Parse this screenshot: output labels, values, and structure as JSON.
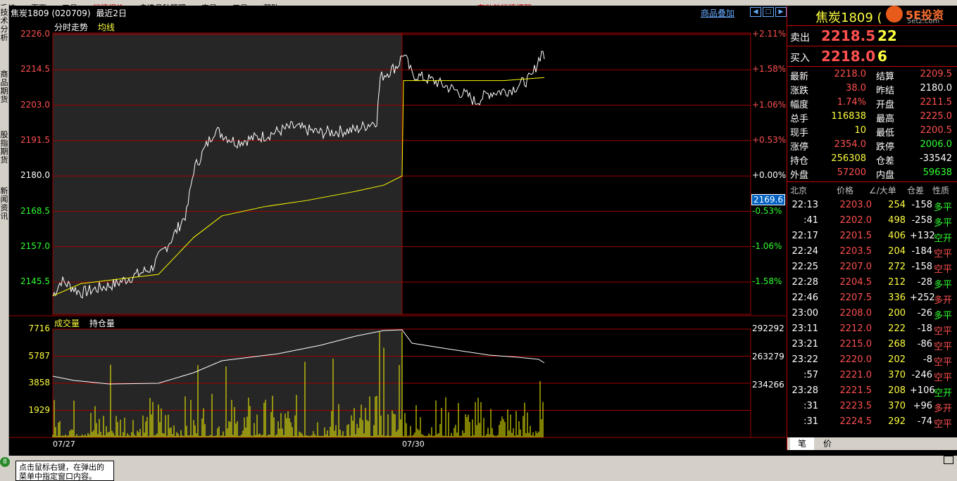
{
  "menubar": {
    "items": [
      "系统",
      "页面",
      "工具",
      "行情报价",
      "自选品种管理",
      "交易",
      "工具",
      "帮助"
    ],
    "highlight_index": 3,
    "notice": "有动效行情提醒"
  },
  "left_tabs": [
    "技术分析",
    "商品期货",
    "股指期货",
    "新闻资讯"
  ],
  "header": {
    "instrument": "焦炭1809 (020709)",
    "range": "最近2日",
    "overlay_btn": "商品叠加"
  },
  "price_panel": {
    "tab_label": "分时走势",
    "avg_label": "均线",
    "left_ticks": [
      "2226.0",
      "2214.5",
      "2203.0",
      "2191.5",
      "2180.0",
      "2168.5",
      "2157.0",
      "2145.5"
    ],
    "right_ticks": [
      "+2.11%",
      "+1.58%",
      "+1.06%",
      "+0.53%",
      "+0.00%",
      "-0.53%",
      "-1.06%",
      "-1.58%"
    ],
    "cursor_price": "2169.6"
  },
  "volume_panel": {
    "vol_label": "成交量",
    "oi_label": "持仓量",
    "left_ticks": [
      "7716",
      "5787",
      "3858",
      "1929"
    ],
    "right_ticks": [
      "292292",
      "263279",
      "234266"
    ]
  },
  "dates": [
    "07/27",
    "07/30"
  ],
  "colors": {
    "up": "#ff5050",
    "down": "#30ff30",
    "grid": "#a00000",
    "price": "#ffffff",
    "avg": "#ffff00",
    "volume": "#ffff00"
  },
  "quote": {
    "title": "焦炭1809 (",
    "brand": "5E投资",
    "brand_site": "5etz.com",
    "sell_label": "卖出",
    "sell_price": "2218.5",
    "sell_qty": "22",
    "buy_label": "买入",
    "buy_price": "2218.0",
    "buy_qty": "6",
    "stats": [
      {
        "l1": "最新",
        "v1": "2218.0",
        "c1": "red",
        "l2": "结算",
        "v2": "2209.5",
        "c2": "red"
      },
      {
        "l1": "涨跌",
        "v1": "38.0",
        "c1": "red",
        "l2": "昨结",
        "v2": "2180.0",
        "c2": "wht"
      },
      {
        "l1": "幅度",
        "v1": "1.74%",
        "c1": "red",
        "l2": "开盘",
        "v2": "2211.5",
        "c2": "red"
      },
      {
        "l1": "总手",
        "v1": "116838",
        "c1": "yel",
        "l2": "最高",
        "v2": "2225.0",
        "c2": "red"
      },
      {
        "l1": "现手",
        "v1": "10",
        "c1": "yel",
        "l2": "最低",
        "v2": "2200.5",
        "c2": "red"
      },
      {
        "l1": "涨停",
        "v1": "2354.0",
        "c1": "red",
        "l2": "跌停",
        "v2": "2006.0",
        "c2": "green"
      },
      {
        "l1": "持仓",
        "v1": "256308",
        "c1": "yel",
        "l2": "仓差",
        "v2": "-33542",
        "c2": "wht"
      },
      {
        "l1": "外盘",
        "v1": "57200",
        "c1": "red",
        "l2": "内盘",
        "v2": "59638",
        "c2": "green"
      }
    ],
    "tick_headers": [
      "北京",
      "价格",
      "∠/大单",
      "仓差",
      "性质"
    ],
    "ticks": [
      {
        "t": "22:13",
        "p": "2203.0",
        "v": "254",
        "d": "-158",
        "n": "多平",
        "nc": "green"
      },
      {
        "t": ":41",
        "p": "2202.0",
        "v": "498",
        "d": "-258",
        "n": "多平",
        "nc": "green"
      },
      {
        "t": "22:17",
        "p": "2201.5",
        "v": "406",
        "d": "+132",
        "n": "空开",
        "nc": "green"
      },
      {
        "t": "22:24",
        "p": "2203.5",
        "v": "204",
        "d": "-184",
        "n": "空平",
        "nc": "red"
      },
      {
        "t": "22:25",
        "p": "2207.0",
        "v": "272",
        "d": "-158",
        "n": "空平",
        "nc": "red"
      },
      {
        "t": "22:28",
        "p": "2204.5",
        "v": "212",
        "d": "-28",
        "n": "多平",
        "nc": "green"
      },
      {
        "t": "22:46",
        "p": "2207.5",
        "v": "336",
        "d": "+252",
        "n": "多开",
        "nc": "red"
      },
      {
        "t": "23:00",
        "p": "2208.0",
        "v": "200",
        "d": "-26",
        "n": "多平",
        "nc": "green"
      },
      {
        "t": "23:11",
        "p": "2212.0",
        "v": "222",
        "d": "-18",
        "n": "空平",
        "nc": "red"
      },
      {
        "t": "23:21",
        "p": "2215.0",
        "v": "268",
        "d": "-86",
        "n": "空平",
        "nc": "red"
      },
      {
        "t": "23:22",
        "p": "2220.0",
        "v": "202",
        "d": "-8",
        "n": "空平",
        "nc": "red"
      },
      {
        "t": ":57",
        "p": "2221.0",
        "v": "370",
        "d": "-246",
        "n": "空平",
        "nc": "red"
      },
      {
        "t": "23:28",
        "p": "2221.5",
        "v": "208",
        "d": "+106",
        "n": "空开",
        "nc": "green"
      },
      {
        "t": ":31",
        "p": "2223.5",
        "v": "370",
        "d": "+96",
        "n": "多开",
        "nc": "red"
      },
      {
        "t": ":31",
        "p": "2224.5",
        "v": "292",
        "d": "-74",
        "n": "空平",
        "nc": "red"
      }
    ],
    "bottom_tabs": [
      "笔",
      "价"
    ]
  },
  "status": {
    "tip": "点击鼠标右键，在弹出的菜单中指定窗口内容。",
    "badge": "8"
  }
}
